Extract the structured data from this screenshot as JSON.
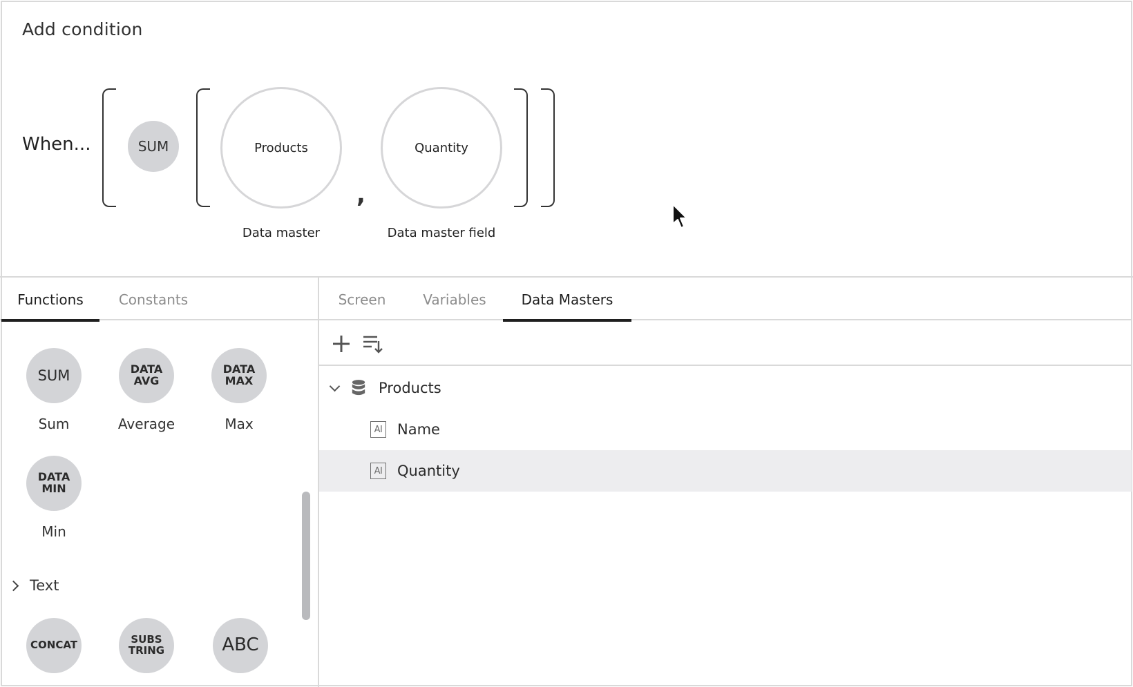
{
  "header": {
    "title": "Add condition",
    "when_label": "When..."
  },
  "expression": {
    "function_chip": "SUM",
    "slots": [
      {
        "value": "Products",
        "caption": "Data master"
      },
      {
        "value": "Quantity",
        "caption": "Data master field"
      }
    ],
    "separator": ","
  },
  "left_panel": {
    "tabs": [
      {
        "label": "Functions",
        "active": true
      },
      {
        "label": "Constants",
        "active": false
      }
    ],
    "functions": [
      {
        "chip": "SUM",
        "label": "Sum"
      },
      {
        "chip": "DATA\nAVG",
        "label": "Average"
      },
      {
        "chip": "DATA\nMAX",
        "label": "Max"
      },
      {
        "chip": "DATA\nMIN",
        "label": "Min"
      }
    ],
    "section_text": "Text",
    "text_functions": [
      {
        "chip": "CONCAT"
      },
      {
        "chip": "SUBS\nTRING"
      },
      {
        "chip": "ABC"
      }
    ]
  },
  "right_panel": {
    "tabs": [
      {
        "label": "Screen",
        "active": false
      },
      {
        "label": "Variables",
        "active": false
      },
      {
        "label": "Data Masters",
        "active": true
      }
    ],
    "toolbar": {
      "add_icon": "plus-icon",
      "sort_icon": "sort-icon"
    },
    "tree": {
      "root": {
        "label": "Products",
        "icon": "database-icon",
        "expanded": true
      },
      "fields": [
        {
          "label": "Name",
          "icon": "text-field-icon",
          "selected": false
        },
        {
          "label": "Quantity",
          "icon": "text-field-icon",
          "selected": true
        }
      ]
    }
  },
  "colors": {
    "chip_bg": "#d3d4d7",
    "border": "#d9d9d9",
    "selected_row": "#ededef",
    "active_tab": "#1f1f1f",
    "inactive_tab": "#8c8c8c"
  }
}
